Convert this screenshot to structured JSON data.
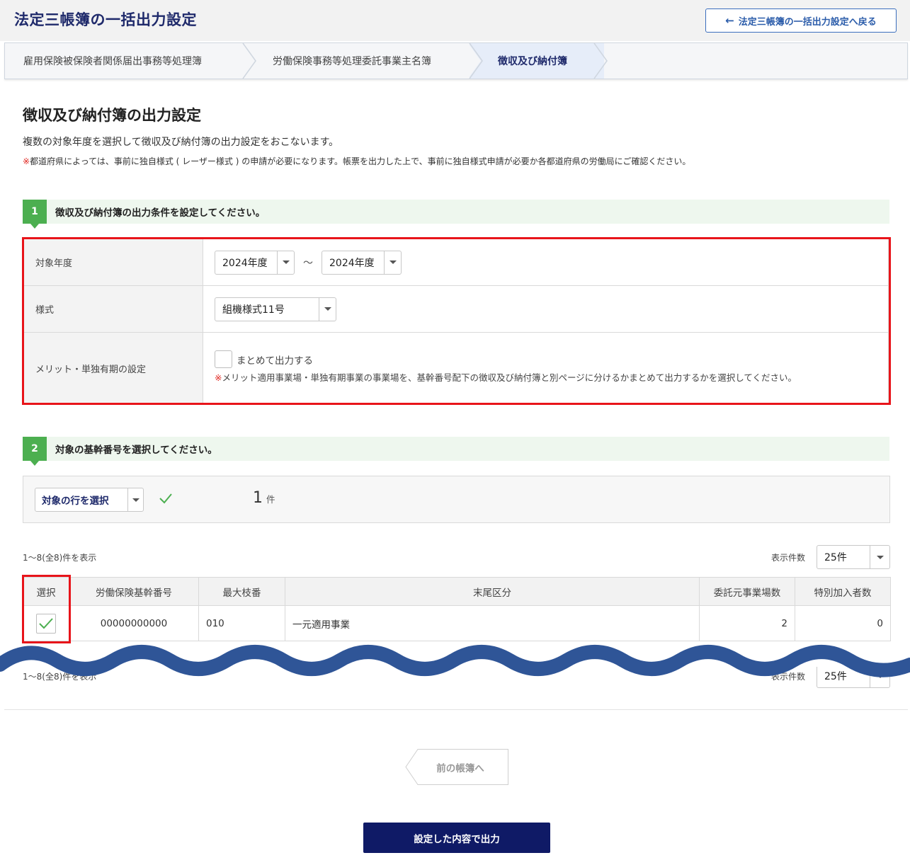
{
  "header": {
    "title": "法定三帳簿の一括出力設定",
    "back_button": "法定三帳簿の一括出力設定へ戻る"
  },
  "steps": [
    {
      "label": "雇用保険被保険者関係届出事務等処理簿"
    },
    {
      "label": "労働保険事務等処理委託事業主名簿"
    },
    {
      "label": "徴収及び納付簿",
      "active": true
    }
  ],
  "page": {
    "title": "徴収及び納付簿の出力設定",
    "description": "複数の対象年度を選択して徴収及び納付簿の出力設定をおこないます。",
    "note_mark": "※",
    "note": "都道府県によっては、事前に独自様式 ( レーザー様式 ) の申請が必要になります。帳票を出力した上で、事前に独自様式申請が必要か各都道府県の労働局にご確認ください。"
  },
  "section1": {
    "number": "1",
    "title": "徴収及び納付簿の出力条件を設定してください。",
    "rows": {
      "year": {
        "label": "対象年度",
        "from": "2024年度",
        "separator": "〜",
        "to": "2024年度"
      },
      "format": {
        "label": "様式",
        "value": "組機様式11号"
      },
      "merit": {
        "label": "メリット・単独有期の設定",
        "checkbox_label": "まとめて出力する",
        "checked": false,
        "note_mark": "※",
        "note": "メリット適用事業場・単独有期事業の事業場を、基幹番号配下の徴収及び納付簿と別ページに分けるかまとめて出力するかを選択してください。"
      }
    }
  },
  "section2": {
    "number": "2",
    "title": "対象の基幹番号を選択してください。",
    "row_select": "対象の行を選択",
    "selected_count": "1",
    "selected_unit": "件"
  },
  "pagination": {
    "info": "1〜8(全8)件を表示",
    "per_page_label": "表示件数",
    "per_page": "25件"
  },
  "table": {
    "columns": [
      "選択",
      "労働保険基幹番号",
      "最大枝番",
      "末尾区分",
      "委託元事業場数",
      "特別加入者数"
    ],
    "rows": [
      {
        "selected": true,
        "number": "00000000000",
        "max_branch": "010",
        "suffix": "一元適用事業",
        "offices": "2",
        "special": "0"
      }
    ]
  },
  "footer": {
    "prev_button": "前の帳簿へ",
    "submit_button": "設定した内容で出力"
  },
  "colors": {
    "navy": "#0f1a66",
    "green": "#4caf50",
    "highlight": "#e8141a"
  }
}
